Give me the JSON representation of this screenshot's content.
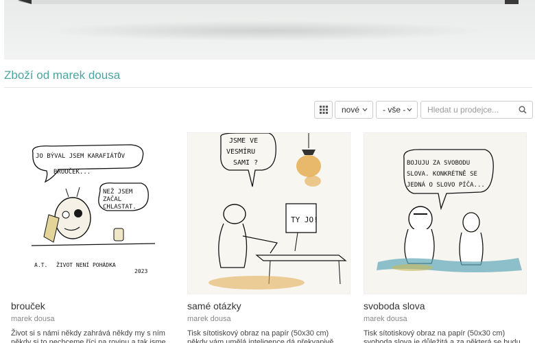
{
  "section": {
    "title": "Zboží od marek dousa"
  },
  "toolbar": {
    "sort_value": "nové",
    "filter_value": "- vše -",
    "search_placeholder": "Hledat u prodejce..."
  },
  "products": [
    {
      "title": "brouček",
      "author": "marek dousa",
      "description": "Život si s námi někdy zahrává někdy my s ním někdy si to nechceme říci na rovinu a tak jsme si",
      "art_lines": [
        "JO BÝVAL JSEM KARAFIÁTŮV",
        "BROUČEK...",
        "NEŽ JSEM",
        "ZAČAL",
        "CHLASTAT.",
        "A.T.",
        "ŽIVOT NENÍ POHÁDKA",
        "2023"
      ]
    },
    {
      "title": "samé otázky",
      "author": "marek dousa",
      "description": "Tisk sítotiskový obraz na papír (50x30 cm) někdy vám umělá inteligence dá překvapivě rychlou",
      "art_lines": [
        "JSME VE",
        "VESMÍRU",
        "SAMI ?",
        "TY JO!"
      ]
    },
    {
      "title": "svoboda slova",
      "author": "marek dousa",
      "description": "Tisk sítotiskový obraz na papír (50x30 cm) svoboda slova je důležitá a za některá se budu bít",
      "art_lines": [
        "BOJUJU ZA SVOBODU",
        "SLOVA. KONKRÉTNĚ SE",
        "JEDNÁ O SLOVO PÍČA..."
      ]
    }
  ]
}
